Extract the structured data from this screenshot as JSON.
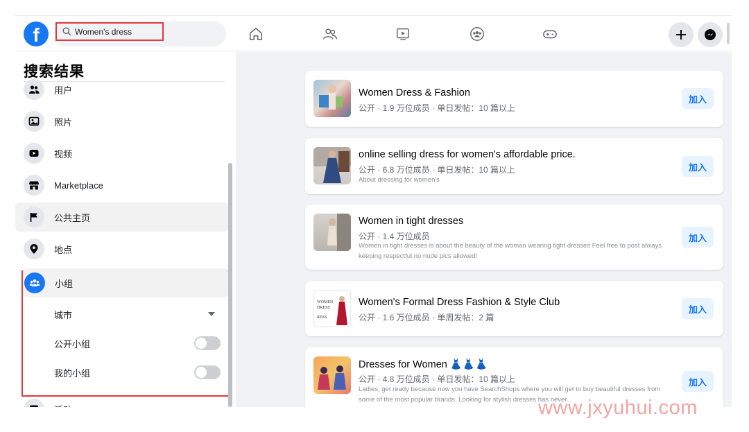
{
  "search": {
    "value": "Women's dress"
  },
  "sidebar": {
    "title": "搜索结果",
    "items": [
      {
        "label": "用户",
        "icon": "people-icon"
      },
      {
        "label": "照片",
        "icon": "photo-icon"
      },
      {
        "label": "视频",
        "icon": "video-icon"
      },
      {
        "label": "Marketplace",
        "icon": "shop-icon"
      },
      {
        "label": "公共主页",
        "icon": "flag-icon"
      },
      {
        "label": "地点",
        "icon": "location-pin-icon"
      },
      {
        "label": "小组",
        "icon": "groups-icon",
        "active": true
      },
      {
        "label": "活动",
        "icon": "calendar-icon"
      }
    ],
    "filters": {
      "city_label": "城市",
      "public_groups_label": "公开小组",
      "my_groups_label": "我的小组"
    }
  },
  "results": [
    {
      "title": "Women Dress & Fashion",
      "meta": "公开 · 1.9 万位成员 · 单日发帖：10 篇以上",
      "description": "",
      "join": "加入"
    },
    {
      "title": "online selling dress for women's affordable price.",
      "meta": "公开 · 6.8 万位成员 · 单日发帖：10 篇以上",
      "description": "About dressing for women's",
      "join": "加入"
    },
    {
      "title": "Women in tight dresses",
      "meta": "公开 · 1.4 万位成员",
      "description": "Women in tight dresses is about the beauty of the woman wearing tight dresses Feel free to post always keeping respectful,no nude pics allowed!",
      "join": "加入"
    },
    {
      "title": "Women's Formal Dress Fashion & Style Club",
      "meta": "公开 · 1.6 万位成员 · 单周发帖：2 篇",
      "description": "",
      "join": "加入"
    },
    {
      "title": "Dresses for Women 👗👗👗",
      "meta": "公开 · 4.8 万位成员 · 单日发帖：10 篇以上",
      "description": "Ladies, get ready because now you have SearchShops where you will get to buy beautiful dresses from some of the most popular brands. Looking for stylish dresses has never...",
      "join": "加入"
    }
  ],
  "watermark": "www.jxyuhui.com",
  "colors": {
    "brand": "#1877f2",
    "highlight_border": "#e0393e",
    "join_bg": "#e7f3ff"
  }
}
